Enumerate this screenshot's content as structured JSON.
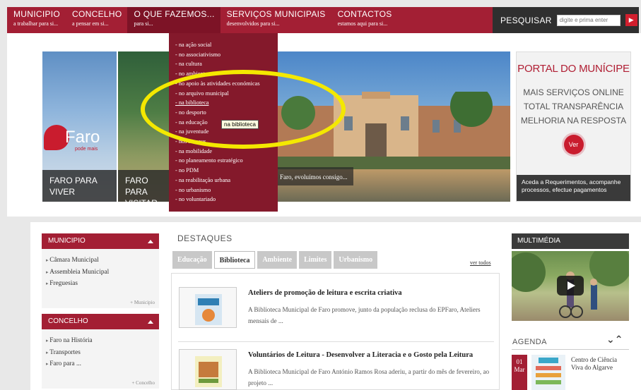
{
  "nav": {
    "items": [
      {
        "title": "MUNICIPIO",
        "sub": "a trabalhar para si..."
      },
      {
        "title": "CONCELHO",
        "sub": "a pensar em si..."
      },
      {
        "title": "O QUE FAZEMOS...",
        "sub": "para si..."
      },
      {
        "title": "SERVIÇOS MUNICIPAIS",
        "sub": "desenvolvidos para si..."
      },
      {
        "title": "CONTACTOS",
        "sub": "estamos aqui para si..."
      }
    ],
    "active_index": 2
  },
  "search": {
    "label": "PESQUISAR",
    "placeholder": "digite e prima enter",
    "go_icon": "arrow-right-icon"
  },
  "hero": {
    "tile_viver": "FARO PARA VIVER",
    "tile_visitar": "FARO PARA VISITAR",
    "main_caption": "Faro, evoluímos consigo...",
    "logo_word": "Faro",
    "logo_tag": "pode mais"
  },
  "dropdown": {
    "items": [
      "- na ação social",
      "- no associativismo",
      "- na cultura",
      "- no ambiente",
      "- no apoio às atividades económicas",
      "- no arquivo municipal",
      "- na biblioteca",
      "- no desporto",
      "- na educação",
      "- na juventude",
      "- nos museus",
      "- na mobilidade",
      "- no planeamento estratégico",
      "- no PDM",
      "- na reabilitação urbana",
      "- no urbanismo",
      "- no voluntariado"
    ],
    "hover_index": 6,
    "tooltip": "na biblioteca"
  },
  "portal": {
    "title": "PORTAL DO MUNÍCIPE",
    "line1": "MAIS SERVIÇOS ONLINE",
    "line2": "TOTAL TRANSPARÊNCIA",
    "line3": "MELHORIA NA RESPOSTA",
    "button": "Ver",
    "footer": "Aceda a Requerimentos, acompanhe processos, efectue pagamentos"
  },
  "municipio_box": {
    "title": "MUNICIPIO",
    "items": [
      "Câmara Municipal",
      "Assembleia Municipal",
      "Freguesias"
    ],
    "more": "+ Municipio"
  },
  "concelho_box": {
    "title": "CONCELHO",
    "items": [
      "Faro na História",
      "Transportes",
      "Faro para ..."
    ],
    "more": "+ Concelho"
  },
  "destaques": {
    "title": "DESTAQUES",
    "tabs": [
      "Educação",
      "Biblioteca",
      "Ambiente",
      "Limites",
      "Urbanismo"
    ],
    "active_tab": 1,
    "ver_todos": "ver todos",
    "news": [
      {
        "title": "Ateliers de promoção de leitura e escrita criativa",
        "desc": "A Biblioteca Municipal de Faro promove, junto da população reclusa do EPFaro, Ateliers mensais de ..."
      },
      {
        "title": "Voluntários de Leitura - Desenvolver a Literacia e o Gosto pela Leitura",
        "desc": "A Biblioteca Municipal de Faro António Ramos Rosa aderiu, a partir do mês de fevereiro, ao projeto ..."
      }
    ]
  },
  "multimedia": {
    "title": "MULTIMÉDIA",
    "play_icon": "play-icon"
  },
  "agenda": {
    "title": "AGENDA",
    "nav": "⌄⌃",
    "item": {
      "day": "01",
      "month": "Mar",
      "text": "Centro de Ciência Viva do Algarve"
    }
  },
  "colors": {
    "brand": "#a31f34",
    "dropdown": "#84192b",
    "highlight": "#f4e800"
  }
}
